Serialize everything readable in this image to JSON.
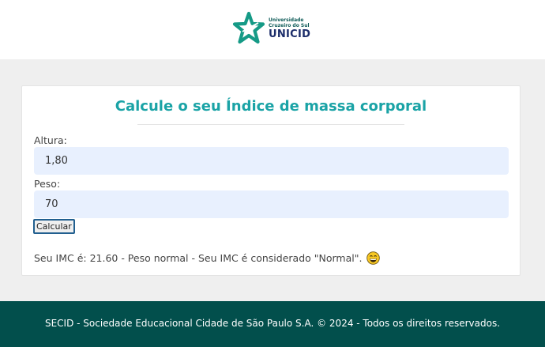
{
  "header": {
    "logo": {
      "line1": "Universidade",
      "line2": "Cruzeiro do Sul",
      "name": "UNICID",
      "icon": "star-logo-icon"
    }
  },
  "form": {
    "title": "Calcule o seu Índice de massa corporal",
    "height_label": "Altura:",
    "height_value": "1,80",
    "weight_label": "Peso:",
    "weight_value": "70",
    "button_label": "Calcular",
    "result_text": "Seu IMC é: 21.60 - Peso normal - Seu IMC é considerado \"Normal\".",
    "result_icon": "grinning-face-emoji"
  },
  "footer": {
    "text": "SECID - Sociedade Educacional Cidade de São Paulo S.A. © 2024 - Todos os direitos reservados."
  },
  "colors": {
    "accent": "#1aa3a6",
    "footer_bg": "#024f4c",
    "logo_green": "#159a86",
    "logo_navy": "#1c2d6a",
    "input_bg": "#e8f0fe"
  }
}
